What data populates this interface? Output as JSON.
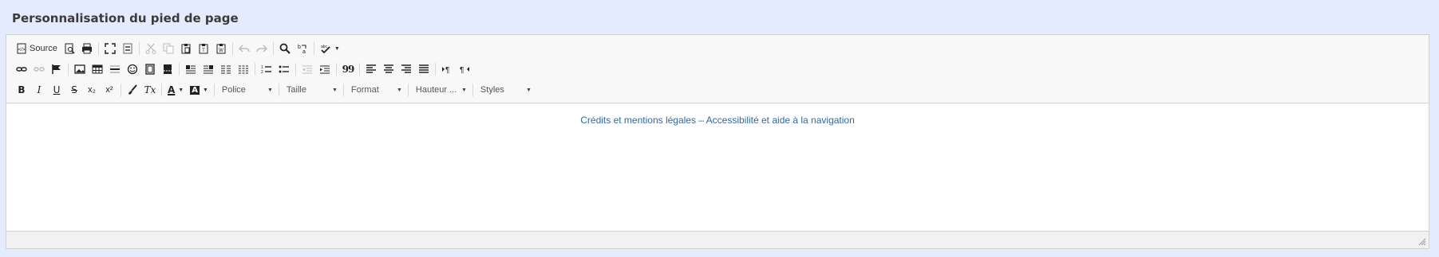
{
  "panel": {
    "title": "Personnalisation du pied de page"
  },
  "toolbar": {
    "source_label": "Source",
    "font_combo": "Police",
    "size_combo": "Taille",
    "format_combo": "Format",
    "line_height_combo": "Hauteur ...",
    "styles_combo": "Styles",
    "bold": "B",
    "italic": "I",
    "underline": "U",
    "strike": "S",
    "subscript": "x₂",
    "superscript": "x²",
    "remove_format": "Tx",
    "text_color": "A",
    "bg_color": "A",
    "blockquote": "99"
  },
  "content": {
    "footer_text": "Crédits et mentions légales – Accessibilité et aide à la navigation"
  },
  "colors": {
    "page_bg": "#e3ebfc",
    "link": "#2a6aa8",
    "toolbar_bg": "#f8f8f8"
  }
}
